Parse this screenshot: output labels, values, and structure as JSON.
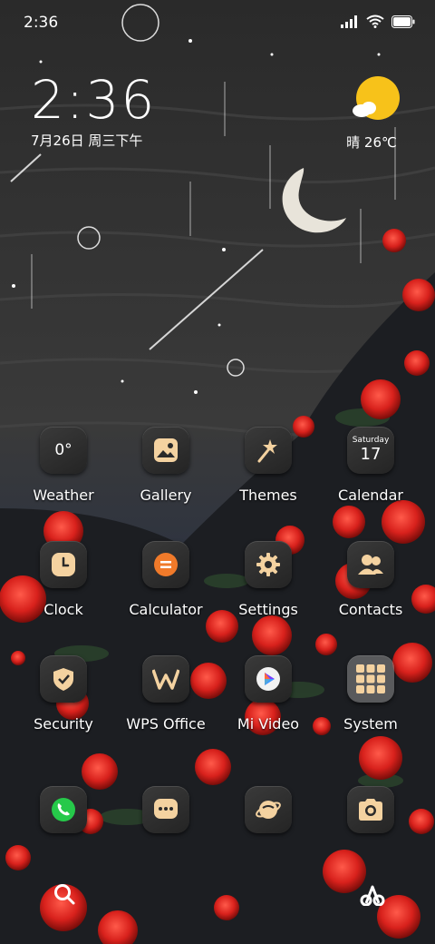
{
  "status_bar": {
    "time": "2:36",
    "battery_level": 0.9
  },
  "clock_widget": {
    "time": "2:36",
    "date": "7月26日 周三下午"
  },
  "weather_widget": {
    "condition_temp": "晴 26℃",
    "icon": "sun-cloud-icon"
  },
  "apps": [
    {
      "label": "Weather",
      "icon": "weather-icon",
      "badge": "0°"
    },
    {
      "label": "Gallery",
      "icon": "gallery-icon"
    },
    {
      "label": "Themes",
      "icon": "themes-icon"
    },
    {
      "label": "Calendar",
      "icon": "calendar-icon",
      "weekday": "Saturday",
      "day": "17"
    },
    {
      "label": "Clock",
      "icon": "clock-icon"
    },
    {
      "label": "Calculator",
      "icon": "calculator-icon"
    },
    {
      "label": "Settings",
      "icon": "settings-icon"
    },
    {
      "label": "Contacts",
      "icon": "contacts-icon"
    },
    {
      "label": "Security",
      "icon": "security-icon"
    },
    {
      "label": "WPS Office",
      "icon": "wps-office-icon"
    },
    {
      "label": "Mi Video",
      "icon": "mi-video-icon"
    },
    {
      "label": "System",
      "icon": "system-folder-icon"
    }
  ],
  "dock": [
    {
      "icon": "phone-icon"
    },
    {
      "icon": "messages-icon"
    },
    {
      "icon": "browser-icon"
    },
    {
      "icon": "camera-icon"
    }
  ],
  "bottom_bar": {
    "left_icon": "search-icon",
    "right_icon": "assistant-icon"
  },
  "colors": {
    "icon_accent": "#f4d2a0",
    "sun": "#f7c21a",
    "rose": "#d8211c",
    "phone_green": "#26c94a"
  }
}
